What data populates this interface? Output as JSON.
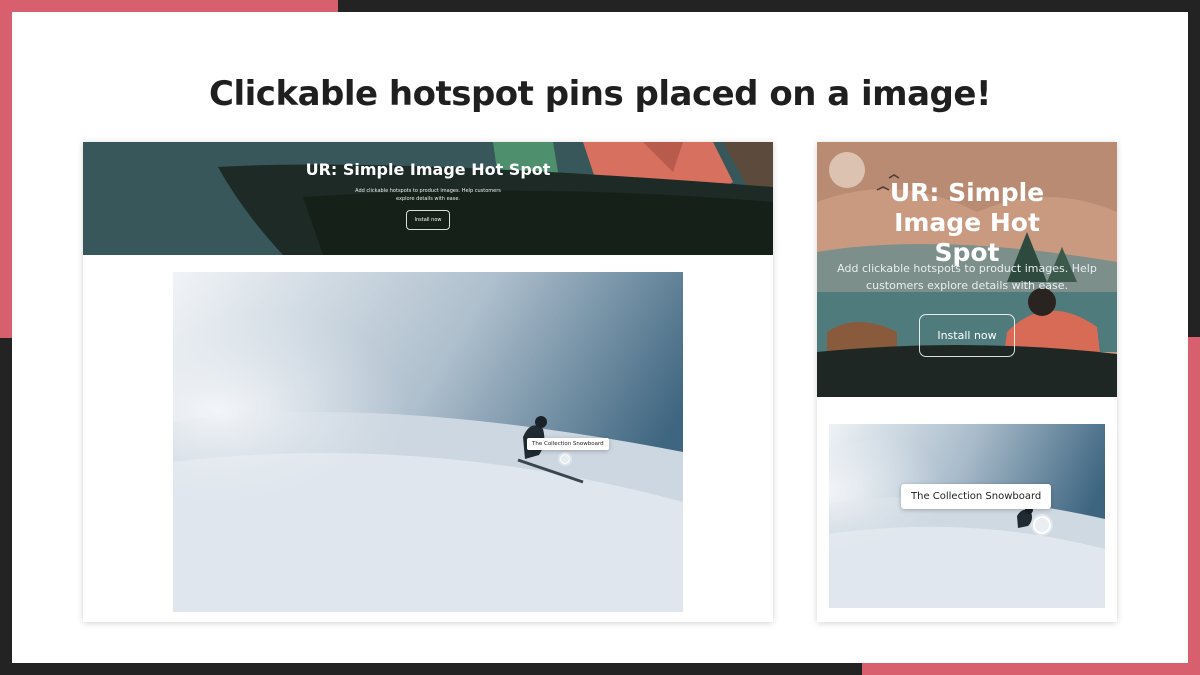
{
  "headline": "Clickable hotspot pins placed on a image!",
  "desktop": {
    "hero_title": "UR: Simple Image Hot Spot",
    "hero_subtitle": "Add clickable hotspots to product images. Help customers explore details with ease.",
    "install_label": "Install now",
    "hotspot_label": "The Collection Snowboard"
  },
  "mobile": {
    "hero_title": "UR: Simple Image Hot Spot",
    "hero_subtitle": "Add clickable hotspots to product images. Help customers explore details with ease.",
    "install_label": "Install now",
    "hotspot_label": "The Collection Snowboard"
  },
  "colors": {
    "accent": "#d85f6e",
    "frame": "#232323",
    "desktop_hero": "#38575a",
    "mobile_hero": "#b98b73"
  }
}
